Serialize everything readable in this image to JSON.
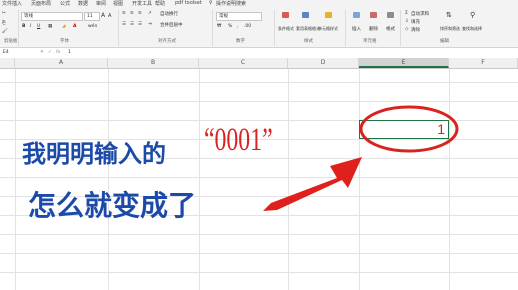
{
  "menu": {
    "tabs": [
      "文件",
      "插入",
      "页面布局",
      "公式",
      "数据",
      "审阅",
      "视图",
      "开发工具",
      "帮助",
      "pdf toolset",
      "操作说明搜索"
    ]
  },
  "ribbon": {
    "font_name": "等线",
    "font_size": "11",
    "number_format": "常规",
    "groups": {
      "clipboard": "剪贴板",
      "font": "字体",
      "alignment": "对齐方式",
      "number": "数字",
      "styles": "样式",
      "cells": "单元格",
      "editing": "编辑"
    },
    "buttons": {
      "wrap_text": "自动换行",
      "merge_center": "合并后居中",
      "conditional_format": "条件格式",
      "table_format": "套用表格格式",
      "cell_style": "单元格样式",
      "insert": "插入",
      "delete": "删除",
      "format": "格式",
      "autosum": "自动求和",
      "fill": "填充",
      "clear": "清除",
      "sort_filter": "排序和筛选",
      "find_select": "查找和选择"
    }
  },
  "formula_bar": {
    "name_box": "E4",
    "content": "1"
  },
  "columns": [
    "A",
    "B",
    "C",
    "D",
    "E",
    "F"
  ],
  "cell": {
    "value": "1"
  },
  "annotation": {
    "line1": "我明明输入的",
    "quoted": "“0001”",
    "line2": "怎么就变成了",
    "color_text": "#1c4aa8",
    "color_red": "#d8231f"
  }
}
